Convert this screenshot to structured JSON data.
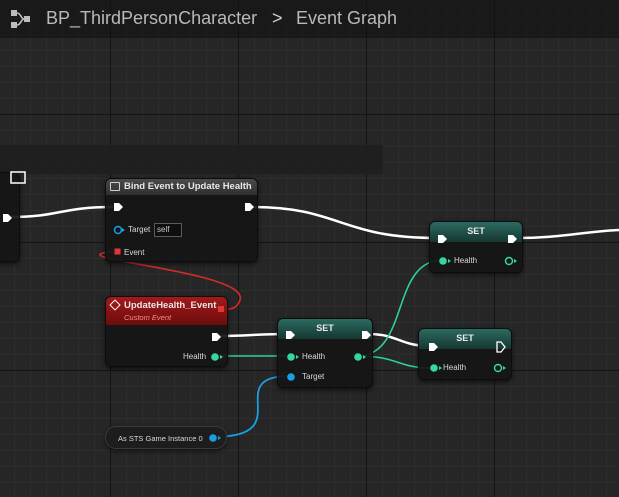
{
  "breadcrumb": {
    "blueprint": "BP_ThirdPersonCharacter",
    "separator": ">",
    "graph": "Event Graph"
  },
  "nodes": {
    "bind_event": {
      "title": "Bind Event to Update Health",
      "target_label": "Target",
      "target_value": "self",
      "event_label": "Event"
    },
    "custom_event": {
      "title": "UpdateHealth_Event",
      "subtitle": "Custom Event",
      "health_label": "Health"
    },
    "set_main": {
      "title": "SET",
      "health_label": "Health",
      "target_label": "Target"
    },
    "set_top": {
      "title": "SET",
      "health_label": "Health"
    },
    "set_bottom": {
      "title": "SET",
      "health_label": "Health"
    },
    "cast": {
      "label": "As STS Game Instance 0"
    }
  },
  "colors": {
    "exec": "#ffffff",
    "float_pin": "#34d7a3",
    "object_pin": "#1a9fe0",
    "delegate_pin": "#e23535",
    "custom_event_header": "#8a1111",
    "set_header": "#1f4f48"
  }
}
